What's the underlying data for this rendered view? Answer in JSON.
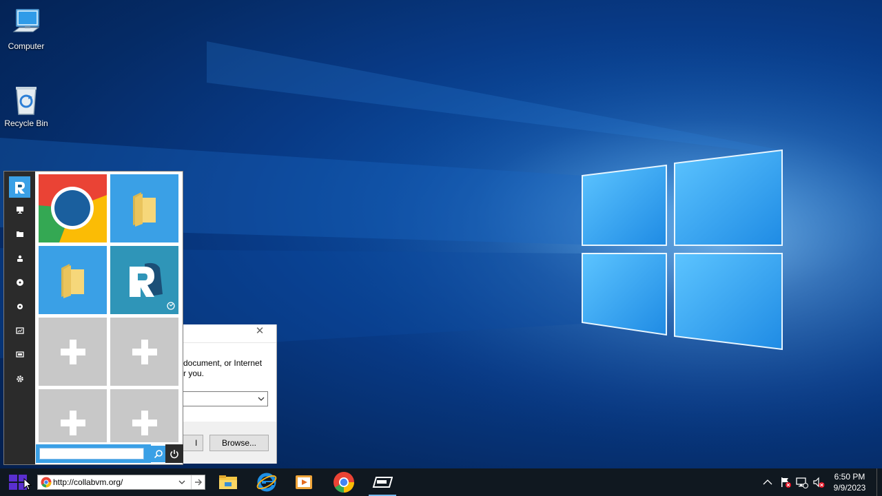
{
  "desktop": {
    "icons": [
      {
        "label": "Computer"
      },
      {
        "label": "Recycle Bin"
      }
    ]
  },
  "start_menu": {
    "rail_items": [
      "r-logo-icon",
      "monitor-icon",
      "folder-icon",
      "users-icon",
      "disk-icon",
      "gear-small-icon",
      "chart-icon",
      "display-icon",
      "settings-icon"
    ],
    "tiles": [
      {
        "name": "chrome-tile",
        "icon": "chrome-icon"
      },
      {
        "name": "folder-tile-1",
        "icon": "folder-icon"
      },
      {
        "name": "folder-tile-2",
        "icon": "folder-icon"
      },
      {
        "name": "r-app-tile",
        "icon": "r-logo-icon"
      },
      {
        "name": "add-tile-1",
        "icon": "plus-icon"
      },
      {
        "name": "add-tile-2",
        "icon": "plus-icon"
      },
      {
        "name": "add-tile-3",
        "icon": "plus-icon"
      },
      {
        "name": "add-tile-4",
        "icon": "plus-icon"
      }
    ],
    "search": {
      "value": "",
      "placeholder": ""
    }
  },
  "run_dialog": {
    "close_glyph": "✕",
    "line1": "document, or Internet",
    "line2": "r you.",
    "combo_value": "",
    "ok_label": "l",
    "browse_label": "Browse..."
  },
  "taskbar": {
    "address": {
      "value": "http://collabvm.org/"
    },
    "apps": [
      "file-explorer-icon",
      "internet-explorer-icon",
      "media-player-icon",
      "chrome-icon",
      "r-app-icon"
    ],
    "clock": {
      "time": "6:50 PM",
      "date": "9/9/2023"
    }
  },
  "colors": {
    "accent": "#3aa0e6",
    "rail": "#2b2b2b",
    "taskbar": "#101820"
  }
}
